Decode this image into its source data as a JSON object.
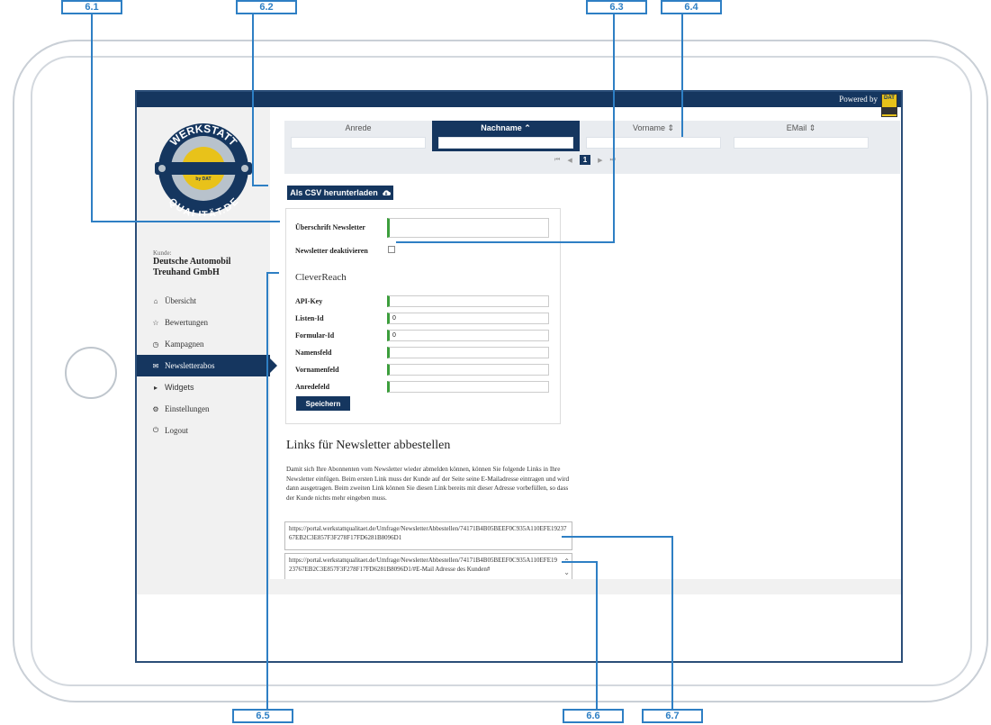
{
  "callouts": {
    "c61": "6.1",
    "c62": "6.2",
    "c63": "6.3",
    "c64": "6.4",
    "c65": "6.5",
    "c66": "6.6",
    "c67": "6.7"
  },
  "topbar": {
    "powered_by": "Powered by",
    "logo_text": "DAT"
  },
  "logo": {
    "top": "WERKSTATT",
    "bottom": "QUALITÄT.DE",
    "center": "by DAT",
    "colors": {
      "navy": "#15365f",
      "gold": "#e8c21a",
      "silver": "#b8c2cc"
    }
  },
  "customer": {
    "label": "Kunde:",
    "name": "Deutsche Automobil Treuhand GmbH"
  },
  "nav": [
    {
      "label": "Übersicht",
      "icon": "home-icon",
      "glyph": "⌂"
    },
    {
      "label": "Bewertungen",
      "icon": "star-icon",
      "glyph": "☆"
    },
    {
      "label": "Kampagnen",
      "icon": "clock-icon",
      "glyph": "◷"
    },
    {
      "label": "Newsletterabos",
      "icon": "envelope-icon",
      "glyph": "✉",
      "active": true
    },
    {
      "label": "Widgets",
      "icon": "caret-right-icon",
      "glyph": "▸"
    },
    {
      "label": "Einstellungen",
      "icon": "gear-icon",
      "glyph": "⚙"
    },
    {
      "label": "Logout",
      "icon": "power-icon",
      "glyph": "⏻"
    }
  ],
  "table": {
    "columns": [
      {
        "label": "Anrede"
      },
      {
        "label": "Nachname ⌃"
      },
      {
        "label": "Vorname ⇕"
      },
      {
        "label": "EMail ⇕"
      }
    ],
    "pager": {
      "first": "⏮",
      "prev": "◀",
      "current": "1",
      "next": "▶",
      "last": "⏭"
    }
  },
  "csv_button": {
    "label": "Als CSV herunterladen",
    "icon": "cloud-download-icon"
  },
  "form": {
    "headline_label": "Überschrift Newsletter",
    "headline_value": "",
    "deactivate_label": "Newsletter deaktivieren",
    "cleverreach_title": "CleverReach",
    "fields": [
      {
        "label": "API-Key",
        "value": ""
      },
      {
        "label": "Listen-Id",
        "value": "0"
      },
      {
        "label": "Formular-Id",
        "value": "0"
      },
      {
        "label": "Namensfeld",
        "value": ""
      },
      {
        "label": "Vornamenfeld",
        "value": ""
      },
      {
        "label": "Anredefeld",
        "value": ""
      }
    ],
    "save_label": "Speichern"
  },
  "unsubscribe": {
    "title": "Links für Newsletter abbestellen",
    "text": "Damit sich Ihre Abonnenten vom Newsletter wieder abmelden können, können Sie folgende Links in Ihre Newsletter einfügen. Beim ersten Link muss der Kunde auf der Seite seine E-Mailadresse eintragen und wird dann ausgetragen. Beim zweiten Link können Sie diesen Link bereits mit dieser Adresse vorbefüllen, so dass der Kunde nichts mehr eingeben muss.",
    "link1": "https://portal.werkstattqualitaet.de/Umfrage/NewsletterAbbestellen/74171B4B05BEEF0C935A110EFE1923767EB2C3E857F3F278F17FD6281B8096D1",
    "link2": "https://portal.werkstattqualitaet.de/Umfrage/NewsletterAbbestellen/74171B4B05BEEF0C935A110EFE1923767EB2C3E857F3F278F17FD6281B8096D1/#E-Mail Adresse des Kunden#"
  }
}
